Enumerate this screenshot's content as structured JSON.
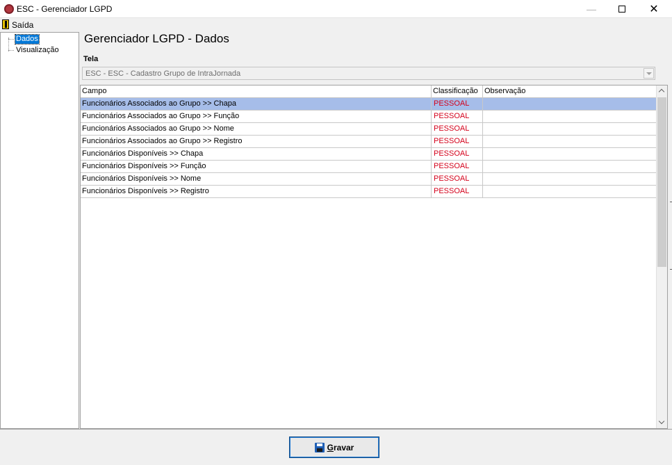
{
  "window": {
    "title": "ESC - Gerenciador LGPD"
  },
  "menu": {
    "items": [
      {
        "label": "Saída"
      }
    ]
  },
  "tree": {
    "items": [
      {
        "label": "Dados",
        "selected": true
      },
      {
        "label": "Visualização",
        "selected": false
      }
    ]
  },
  "main": {
    "title": "Gerenciador LGPD - Dados",
    "tela_label": "Tela",
    "tela_value": "ESC - ESC - Cadastro Grupo de IntraJornada"
  },
  "grid": {
    "columns": [
      "Campo",
      "Classificação",
      "Observação"
    ],
    "rows": [
      {
        "campo": "Funcionários Associados ao Grupo >> Chapa",
        "classificacao": "PESSOAL",
        "observacao": "",
        "selected": true
      },
      {
        "campo": "Funcionários Associados ao Grupo >> Função",
        "classificacao": "PESSOAL",
        "observacao": "",
        "selected": false
      },
      {
        "campo": "Funcionários Associados ao Grupo >> Nome",
        "classificacao": "PESSOAL",
        "observacao": "",
        "selected": false
      },
      {
        "campo": "Funcionários Associados ao Grupo >> Registro",
        "classificacao": "PESSOAL",
        "observacao": "",
        "selected": false
      },
      {
        "campo": "Funcionários Disponíveis >> Chapa",
        "classificacao": "PESSOAL",
        "observacao": "",
        "selected": false
      },
      {
        "campo": "Funcionários Disponíveis >> Função",
        "classificacao": "PESSOAL",
        "observacao": "",
        "selected": false
      },
      {
        "campo": "Funcionários Disponíveis >> Nome",
        "classificacao": "PESSOAL",
        "observacao": "",
        "selected": false
      },
      {
        "campo": "Funcionários Disponíveis >> Registro",
        "classificacao": "PESSOAL",
        "observacao": "",
        "selected": false
      }
    ]
  },
  "footer": {
    "save_label": "Gravar"
  },
  "colors": {
    "selection": "#a6bde9",
    "classification_text": "#d4001a",
    "tree_selection": "#0078d7"
  }
}
